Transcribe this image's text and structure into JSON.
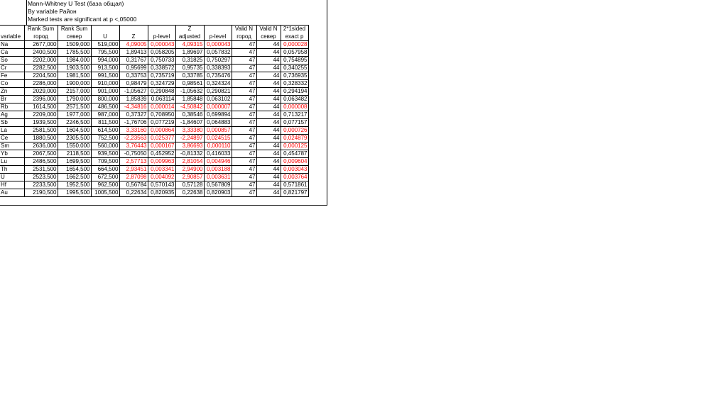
{
  "header": {
    "line1": "Mann-Whitney U Test (база общая)",
    "line2": "By variable Район",
    "line3": "Marked tests are significant at p <,05000"
  },
  "columns": [
    {
      "l1": "",
      "l2": "variable"
    },
    {
      "l1": "Rank Sum",
      "l2": "город"
    },
    {
      "l1": "Rank Sum",
      "l2": "север"
    },
    {
      "l1": "U",
      "l2": ""
    },
    {
      "l1": "Z",
      "l2": ""
    },
    {
      "l1": "p-level",
      "l2": ""
    },
    {
      "l1": "Z",
      "l2": "adjusted"
    },
    {
      "l1": "p-level",
      "l2": ""
    },
    {
      "l1": "Valid N",
      "l2": "город"
    },
    {
      "l1": "Valid N",
      "l2": "север"
    },
    {
      "l1": "2*1sided",
      "l2": "exact p"
    }
  ],
  "rows": [
    {
      "var": "Na",
      "rs1": "2677,000",
      "rs2": "1509,000",
      "u": "519,000",
      "z": "4,09005",
      "p": "0,000043",
      "za": "4,09315",
      "pa": "0,000043",
      "n1": "47",
      "n2": "44",
      "ep": "0,000028",
      "sig": true
    },
    {
      "var": "Ca",
      "rs1": "2400,500",
      "rs2": "1785,500",
      "u": "795,500",
      "z": "1,89413",
      "p": "0,058205",
      "za": "1,89697",
      "pa": "0,057832",
      "n1": "47",
      "n2": "44",
      "ep": "0,057958",
      "sig": false
    },
    {
      "var": "So",
      "rs1": "2202,000",
      "rs2": "1984,000",
      "u": "994,000",
      "z": "0,31767",
      "p": "0,750733",
      "za": "0,31825",
      "pa": "0,750297",
      "n1": "47",
      "n2": "44",
      "ep": "0,754895",
      "sig": false
    },
    {
      "var": "Cr",
      "rs1": "2282,500",
      "rs2": "1903,500",
      "u": "913,500",
      "z": "0,95699",
      "p": "0,338572",
      "za": "0,95735",
      "pa": "0,338393",
      "n1": "47",
      "n2": "44",
      "ep": "0,340255",
      "sig": false
    },
    {
      "var": "Fe",
      "rs1": "2204,500",
      "rs2": "1981,500",
      "u": "991,500",
      "z": "0,33753",
      "p": "0,735719",
      "za": "0,33785",
      "pa": "0,735476",
      "n1": "47",
      "n2": "44",
      "ep": "0,736935",
      "sig": false
    },
    {
      "var": "Co",
      "rs1": "2286,000",
      "rs2": "1900,000",
      "u": "910,000",
      "z": "0,98479",
      "p": "0,324729",
      "za": "0,98561",
      "pa": "0,324324",
      "n1": "47",
      "n2": "44",
      "ep": "0,328332",
      "sig": false
    },
    {
      "var": "Zn",
      "rs1": "2029,000",
      "rs2": "2157,000",
      "u": "901,000",
      "z": "-1,05627",
      "p": "0,290848",
      "za": "-1,05632",
      "pa": "0,290821",
      "n1": "47",
      "n2": "44",
      "ep": "0,294194",
      "sig": false
    },
    {
      "var": "Br",
      "rs1": "2396,000",
      "rs2": "1790,000",
      "u": "800,000",
      "z": "1,85839",
      "p": "0,063114",
      "za": "1,85848",
      "pa": "0,063102",
      "n1": "47",
      "n2": "44",
      "ep": "0,063482",
      "sig": false
    },
    {
      "var": "Rb",
      "rs1": "1614,500",
      "rs2": "2571,500",
      "u": "486,500",
      "z": "-4,34816",
      "p": "0,000014",
      "za": "-4,50842",
      "pa": "0,000007",
      "n1": "47",
      "n2": "44",
      "ep": "0,000008",
      "sig": true
    },
    {
      "var": "Ag",
      "rs1": "2209,000",
      "rs2": "1977,000",
      "u": "987,000",
      "z": "0,37327",
      "p": "0,708950",
      "za": "0,38546",
      "pa": "0,699894",
      "n1": "47",
      "n2": "44",
      "ep": "0,713217",
      "sig": false
    },
    {
      "var": "Sb",
      "rs1": "1939,500",
      "rs2": "2246,500",
      "u": "811,500",
      "z": "-1,76706",
      "p": "0,077219",
      "za": "-1,84607",
      "pa": "0,064883",
      "n1": "47",
      "n2": "44",
      "ep": "0,077157",
      "sig": false
    },
    {
      "var": "La",
      "rs1": "2581,500",
      "rs2": "1604,500",
      "u": "614,500",
      "z": "3,33160",
      "p": "0,000864",
      "za": "3,33380",
      "pa": "0,000857",
      "n1": "47",
      "n2": "44",
      "ep": "0,000726",
      "sig": true
    },
    {
      "var": "Ce",
      "rs1": "1880,500",
      "rs2": "2305,500",
      "u": "752,500",
      "z": "-2,23563",
      "p": "0,025377",
      "za": "-2,24897",
      "pa": "0,024515",
      "n1": "47",
      "n2": "44",
      "ep": "0,024879",
      "sig": true
    },
    {
      "var": "Sm",
      "rs1": "2636,000",
      "rs2": "1550,000",
      "u": "560,000",
      "z": "3,76443",
      "p": "0,000167",
      "za": "3,86693",
      "pa": "0,000110",
      "n1": "47",
      "n2": "44",
      "ep": "0,000125",
      "sig": true
    },
    {
      "var": "Yb",
      "rs1": "2067,500",
      "rs2": "2118,500",
      "u": "939,500",
      "z": "-0,75050",
      "p": "0,452952",
      "za": "-0,81332",
      "pa": "0,416033",
      "n1": "47",
      "n2": "44",
      "ep": "0,454787",
      "sig": false
    },
    {
      "var": "Lu",
      "rs1": "2486,500",
      "rs2": "1699,500",
      "u": "709,500",
      "z": "2,57713",
      "p": "0,009963",
      "za": "2,81054",
      "pa": "0,004946",
      "n1": "47",
      "n2": "44",
      "ep": "0,009604",
      "sig": true
    },
    {
      "var": "Th",
      "rs1": "2531,500",
      "rs2": "1654,500",
      "u": "664,500",
      "z": "2,93451",
      "p": "0,003341",
      "za": "2,94900",
      "pa": "0,003188",
      "n1": "47",
      "n2": "44",
      "ep": "0,003043",
      "sig": true
    },
    {
      "var": "U",
      "rs1": "2523,500",
      "rs2": "1662,500",
      "u": "672,500",
      "z": "2,87098",
      "p": "0,004092",
      "za": "2,90857",
      "pa": "0,003631",
      "n1": "47",
      "n2": "44",
      "ep": "0,003764",
      "sig": true
    },
    {
      "var": "Hf",
      "rs1": "2233,500",
      "rs2": "1952,500",
      "u": "962,500",
      "z": "0,56784",
      "p": "0,570143",
      "za": "0,57128",
      "pa": "0,567809",
      "n1": "47",
      "n2": "44",
      "ep": "0,571861",
      "sig": false
    },
    {
      "var": "Au",
      "rs1": "2190,500",
      "rs2": "1995,500",
      "u": "1005,500",
      "z": "0,22634",
      "p": "0,820935",
      "za": "0,22638",
      "pa": "0,820903",
      "n1": "47",
      "n2": "44",
      "ep": "0,821797",
      "sig": false
    }
  ],
  "colors": {
    "significant": "#ff0000",
    "normal": "#000000",
    "grid": "#000000"
  }
}
